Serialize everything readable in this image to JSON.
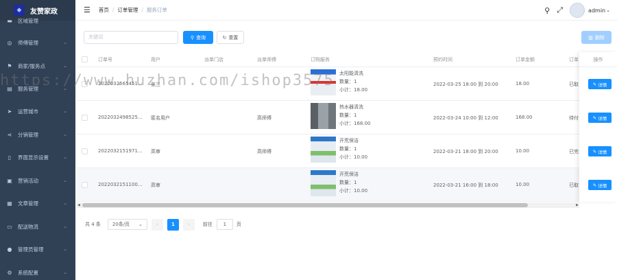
{
  "app": {
    "title": "友赞家政"
  },
  "sidebar": {
    "items": [
      {
        "label": "区域管理",
        "icon": "home-icon"
      },
      {
        "label": "师傅管理",
        "icon": "user-group-icon"
      },
      {
        "label": "商家/服务点",
        "icon": "flag-icon"
      },
      {
        "label": "服务管理",
        "icon": "clipboard-icon"
      },
      {
        "label": "运营城市",
        "icon": "send-icon"
      },
      {
        "label": "分销管理",
        "icon": "share-icon"
      },
      {
        "label": "界面显示设置",
        "icon": "mobile-icon"
      },
      {
        "label": "营销活动",
        "icon": "gift-icon"
      },
      {
        "label": "文章管理",
        "icon": "document-icon"
      },
      {
        "label": "配送物流",
        "icon": "truck-icon"
      },
      {
        "label": "管理员管理",
        "icon": "person-icon"
      },
      {
        "label": "系统配置",
        "icon": "gear-icon"
      }
    ]
  },
  "header": {
    "breadcrumb": [
      "首页",
      "订单管理",
      "服务订单"
    ],
    "user": "admin"
  },
  "toolbar": {
    "search_placeholder": "关键词",
    "query_label": "查询",
    "reset_label": "重置",
    "delete_label": "删除"
  },
  "table": {
    "columns": {
      "order_no": "订单号",
      "user": "用户",
      "store": "派单门店",
      "master": "派单师傅",
      "service": "订购服务",
      "time": "预约时间",
      "amount": "订单金额",
      "status": "订单",
      "op": "操作"
    },
    "rows": [
      {
        "order_no": "2022032565451...",
        "user": "张三",
        "store": "",
        "master": "",
        "service_name": "太阳能清洗",
        "qty": "数量：1",
        "subtotal": "小计：18.00",
        "time": "2022-03-25 18:00 到 20:00",
        "amount": "18.00",
        "status": "已取",
        "detail": "详情"
      },
      {
        "order_no": "2022032498525...",
        "user": "匿名用户",
        "store": "",
        "master": "高师傅",
        "service_name": "热水器清洗",
        "qty": "数量：1",
        "subtotal": "小计：168.00",
        "time": "2022-03-24 10:00 到 12:00",
        "amount": "168.00",
        "status": "待付",
        "detail": "详情"
      },
      {
        "order_no": "2022032151971...",
        "user": "高审",
        "store": "",
        "master": "高师傅",
        "service_name": "开荒保洁",
        "qty": "数量：1",
        "subtotal": "小计：10.00",
        "time": "2022-03-21 18:00 到 20:00",
        "amount": "10.00",
        "status": "已完",
        "detail": "详情"
      },
      {
        "order_no": "2022032151100...",
        "user": "高审",
        "store": "",
        "master": "",
        "service_name": "开荒保洁",
        "qty": "数量：1",
        "subtotal": "小计：10.00",
        "time": "2022-03-21 16:00 到 18:00",
        "amount": "10.00",
        "status": "已取",
        "detail": "详情"
      }
    ]
  },
  "pagination": {
    "total": "共 4 条",
    "page_size": "20条/页",
    "current": "1",
    "goto_label": "前往",
    "goto_value": "1",
    "page_suffix": "页"
  },
  "watermark": "https://www.huzhan.com/ishop3575"
}
